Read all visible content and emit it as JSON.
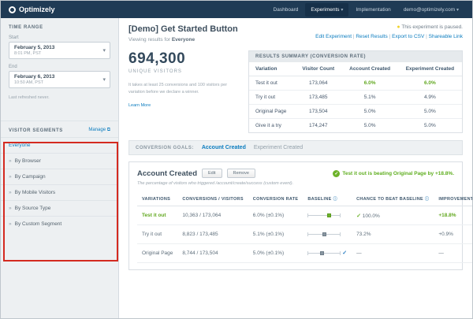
{
  "navbar": {
    "brand": "Optimizely",
    "items": [
      {
        "label": "Dashboard"
      },
      {
        "label": "Experiments"
      },
      {
        "label": "Implementation"
      },
      {
        "label": "demo@optimizely.com"
      }
    ]
  },
  "icons": {
    "caret_down": "▾",
    "chevron_right": "»",
    "check": "✓",
    "info": "ⓘ",
    "external": "⧉",
    "dot": "●"
  },
  "sidebar": {
    "time_range_title": "TIME RANGE",
    "start_label": "Start",
    "start_date": "February 5, 2013",
    "start_time": "8:01 PM, PST",
    "end_label": "End",
    "end_date": "February 6, 2013",
    "end_time": "10:50 AM, PST",
    "last_refreshed": "Last refreshed never.",
    "segments_title": "VISITOR SEGMENTS",
    "manage_label": "Manage",
    "segments": [
      {
        "label": "Everyone"
      },
      {
        "label": "By Browser"
      },
      {
        "label": "By Campaign"
      },
      {
        "label": "By Mobile Visitors"
      },
      {
        "label": "By Source Type"
      },
      {
        "label": "By Custom Segment"
      }
    ]
  },
  "header": {
    "title": "[Demo] Get Started Button",
    "subtitle_prefix": "Viewing results for",
    "subtitle_segment": "Everyone",
    "status": "This experiment is paused.",
    "links": [
      "Edit Experiment",
      "Reset Results",
      "Export to CSV",
      "Shareable Link"
    ]
  },
  "stats": {
    "unique_visitors": "694,300",
    "unique_visitors_label": "UNIQUE VISITORS",
    "note": "It takes at least 25 conversions and 100 visitors per variation before we declare a winner.",
    "learn_more": "Learn More"
  },
  "results_summary": {
    "title": "RESULTS SUMMARY (CONVERSION RATE)",
    "columns": [
      "Variation",
      "Visitor Count",
      "Account Created",
      "Experiment Created"
    ],
    "rows": [
      {
        "variation": "Test it out",
        "visitors": "173,064",
        "account": "6.0%",
        "experiment": "6.0%"
      },
      {
        "variation": "Try it out",
        "visitors": "173,485",
        "account": "5.1%",
        "experiment": "4.9%"
      },
      {
        "variation": "Original Page",
        "visitors": "173,504",
        "account": "5.0%",
        "experiment": "5.0%"
      },
      {
        "variation": "Give it a try",
        "visitors": "174,247",
        "account": "5.0%",
        "experiment": "5.0%"
      }
    ]
  },
  "goals": {
    "label": "CONVERSION GOALS:",
    "tabs": [
      {
        "label": "Account Created"
      },
      {
        "label": "Experiment Created"
      }
    ]
  },
  "goal_panel": {
    "title": "Account Created",
    "edit_label": "Edit",
    "remove_label": "Remove",
    "description": "The percentage of visitors who triggered /account/create/success (custom event).",
    "winner_note": "Test it out is beating Original Page by +18.8%.",
    "columns": [
      "VARIATIONS",
      "CONVERSIONS / VISITORS",
      "CONVERSION RATE",
      "BASELINE",
      "CHANCE TO BEAT BASELINE",
      "IMPROVEMENT"
    ],
    "rows": [
      {
        "variation": "Test it out",
        "conversions": "10,363 / 173,064",
        "rate": "6.0% (±0.1%)",
        "chance": "100.0%",
        "improvement": "+18.8%"
      },
      {
        "variation": "Try it out",
        "conversions": "8,823 / 173,485",
        "rate": "5.1% (±0.1%)",
        "chance": "73.2%",
        "improvement": "+0.9%"
      },
      {
        "variation": "Original Page",
        "conversions": "8,744 / 173,504",
        "rate": "5.0% (±0.1%)",
        "chance": "—",
        "improvement": "—"
      }
    ]
  },
  "colors": {
    "navbar_navy": "#1f3b55",
    "accent_blue": "#0b7cbf",
    "positive_green": "#62a820",
    "paused_yellow": "#f0d22c",
    "annotation_red": "#d42a20"
  }
}
